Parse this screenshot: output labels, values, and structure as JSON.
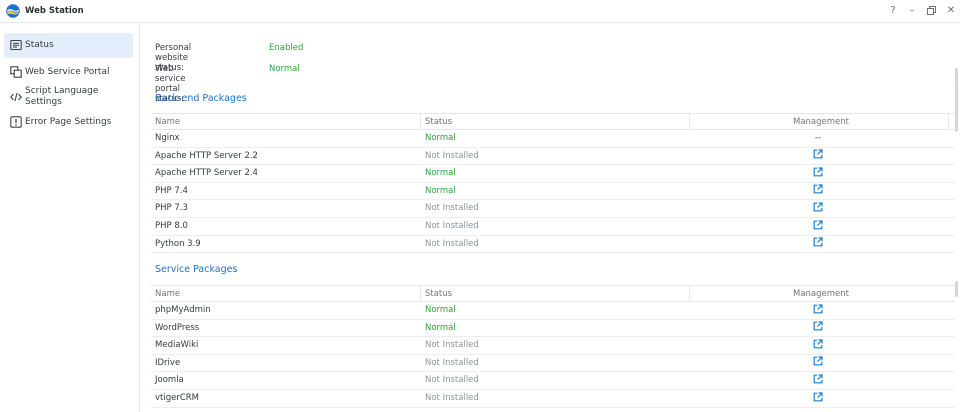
{
  "window": {
    "title": "Web Station",
    "help": "?",
    "minimize": "–",
    "restore": "▫",
    "close": "✕"
  },
  "sidebar": {
    "items": [
      {
        "label": "Status",
        "icon": "status-list-icon",
        "active": true
      },
      {
        "label": "Web Service Portal",
        "icon": "portal-icon"
      },
      {
        "label": "Script Language",
        "label2": "Settings",
        "icon": "code-icon"
      },
      {
        "label": "Error Page Settings",
        "icon": "alert-icon"
      }
    ]
  },
  "status": {
    "personal_label": "Personal website status:",
    "personal_value": "Enabled",
    "portal_label": "Web service portal status:",
    "portal_value": "Normal"
  },
  "backend": {
    "title": "Back-end Packages",
    "columns": [
      "Name",
      "Status",
      "Management"
    ],
    "rows": [
      {
        "name": "Nginx",
        "status": "Normal",
        "mgmt": "--"
      },
      {
        "name": "Apache HTTP Server 2.2",
        "status": "Not Installed",
        "mgmt": ""
      },
      {
        "name": "Apache HTTP Server 2.4",
        "status": "Normal",
        "mgmt": ""
      },
      {
        "name": "PHP 7.4",
        "status": "Normal",
        "mgmt": ""
      },
      {
        "name": "PHP 7.3",
        "status": "Not Installed",
        "mgmt": ""
      },
      {
        "name": "PHP 8.0",
        "status": "Not Installed",
        "mgmt": ""
      },
      {
        "name": "Python 3.9",
        "status": "Not Installed",
        "mgmt": ""
      }
    ]
  },
  "service": {
    "title": "Service Packages",
    "columns": [
      "Name",
      "Status",
      "Management"
    ],
    "rows": [
      {
        "name": "phpMyAdmin",
        "status": "Normal",
        "mgmt": ""
      },
      {
        "name": "WordPress",
        "status": "Normal",
        "mgmt": ""
      },
      {
        "name": "MediaWiki",
        "status": "Not Installed",
        "mgmt": ""
      },
      {
        "name": "IDrive",
        "status": "Not Installed",
        "mgmt": ""
      },
      {
        "name": "Joomla",
        "status": "Not Installed",
        "mgmt": ""
      },
      {
        "name": "vtigerCRM",
        "status": "Not Installed",
        "mgmt": ""
      }
    ]
  },
  "colors": {
    "accent": "#1e72c8",
    "ok": "#2ea335",
    "muted": "#8e949a",
    "link_icon": "#1a7fd1",
    "active_bg": "#e4eefa"
  }
}
